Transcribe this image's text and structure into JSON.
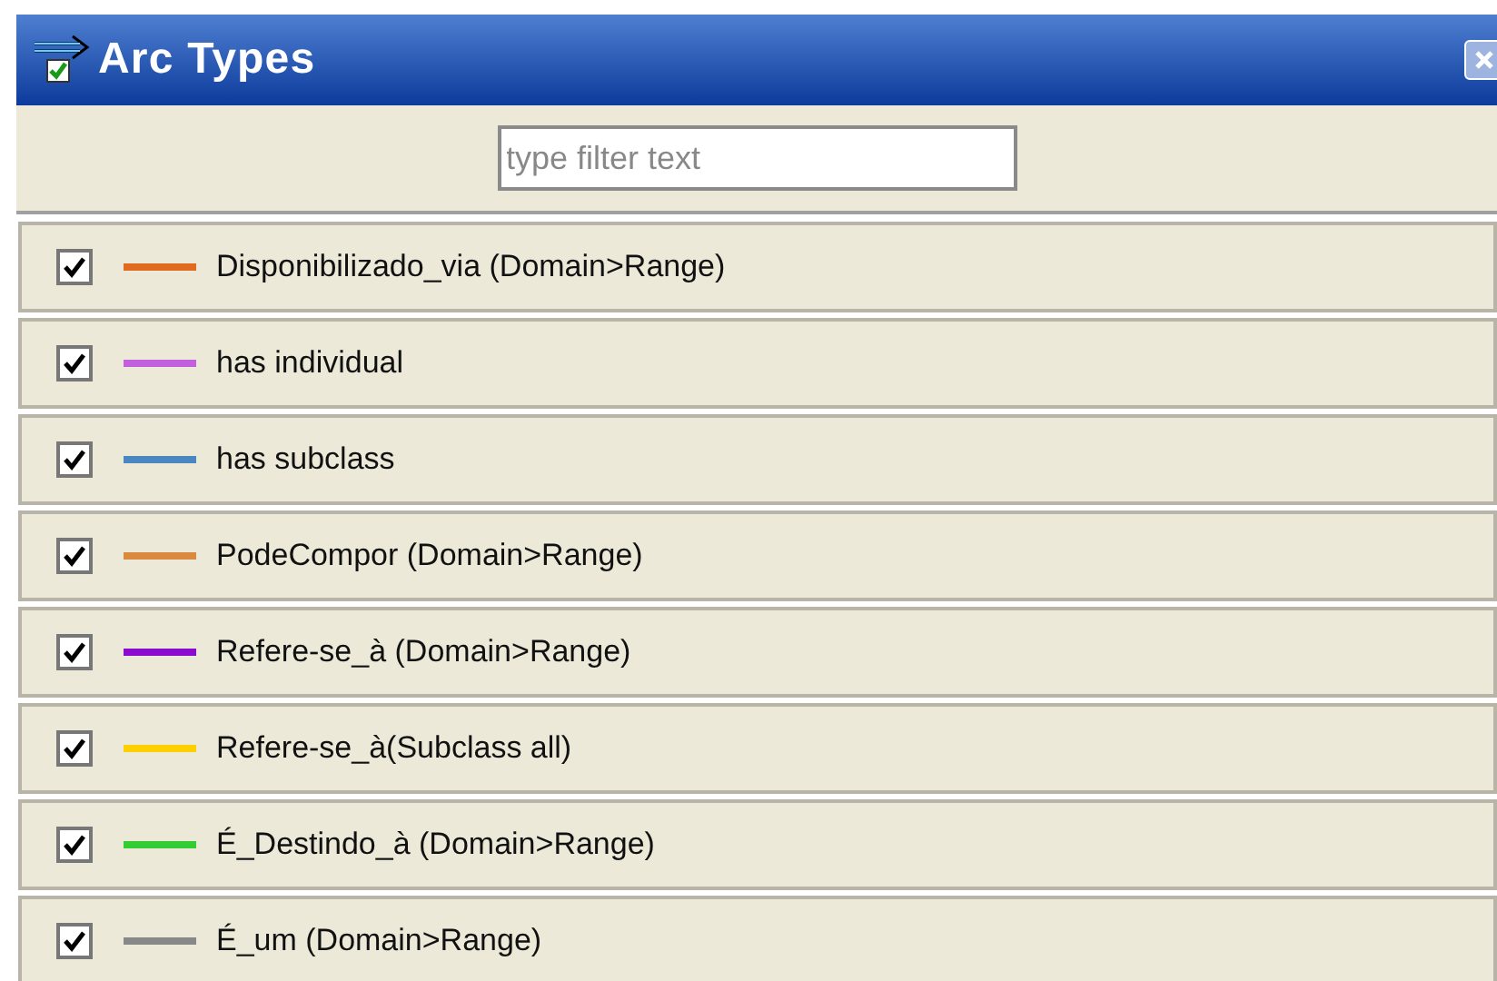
{
  "window": {
    "title": "Arc Types"
  },
  "filter": {
    "placeholder": "type filter text"
  },
  "arc_types": [
    {
      "label": "Disponibilizado_via (Domain>Range)",
      "checked": true,
      "color": "#e06a1e"
    },
    {
      "label": "has individual",
      "checked": true,
      "color": "#c25fdc"
    },
    {
      "label": "has subclass",
      "checked": true,
      "color": "#4a86c0"
    },
    {
      "label": "PodeCompor (Domain>Range)",
      "checked": true,
      "color": "#d98a3e"
    },
    {
      "label": "Refere-se_à (Domain>Range)",
      "checked": true,
      "color": "#8a0ad0"
    },
    {
      "label": "Refere-se_à(Subclass all)",
      "checked": true,
      "color": "#ffd000"
    },
    {
      "label": "É_Destindo_à (Domain>Range)",
      "checked": true,
      "color": "#33cc33"
    },
    {
      "label": "É_um (Domain>Range)",
      "checked": true,
      "color": "#888888"
    }
  ]
}
